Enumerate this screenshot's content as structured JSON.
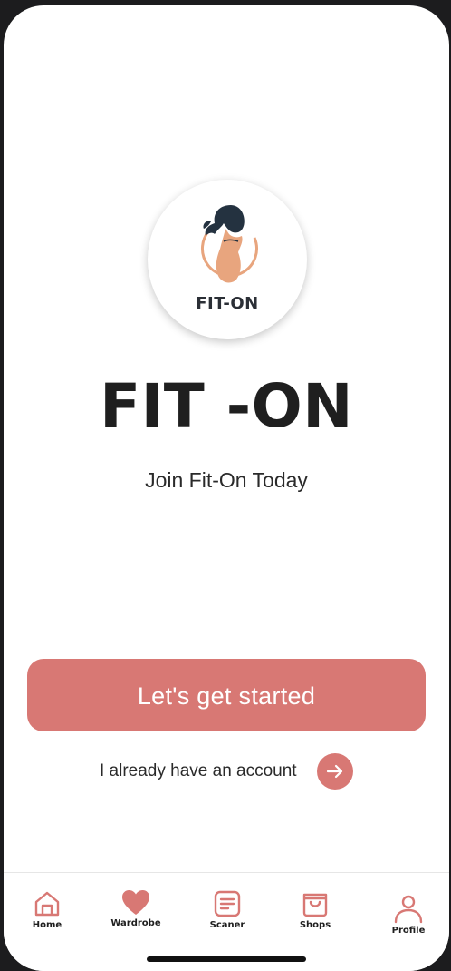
{
  "logo": {
    "text": "FIT-ON"
  },
  "title": "FIT -ON",
  "tagline": "Join Fit-On Today",
  "cta": {
    "label": "Let's get started"
  },
  "login": {
    "text": "I already have an account"
  },
  "tabs": [
    {
      "label": "Home",
      "icon": "home-icon"
    },
    {
      "label": "Wardrobe",
      "icon": "heart-icon"
    },
    {
      "label": "Scaner",
      "icon": "document-icon"
    },
    {
      "label": "Shops",
      "icon": "shopping-bag-icon"
    },
    {
      "label": "Profile",
      "icon": "user-icon"
    }
  ],
  "colors": {
    "accent": "#d87874",
    "logo_peach": "#e8a57e",
    "text_dark": "#1f1f1f"
  }
}
